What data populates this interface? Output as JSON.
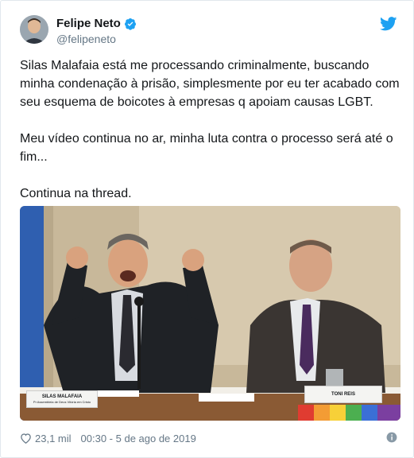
{
  "tweet": {
    "author": {
      "name": "Felipe Neto",
      "handle": "@felipeneto",
      "verified": true
    },
    "paragraphs": [
      "Silas Malafaia está me processando criminalmente, buscando minha condenação à prisão, simplesmente por eu ter acabado com seu esquema de boicotes à empresas q apoiam causas LGBT.",
      "Meu vídeo continua no ar, minha luta contra o processo será até o fim...",
      "Continua na thread."
    ],
    "photo": {
      "nameplate_left": "SILAS MALAFAIA",
      "nameplate_left_sub": "Pr Assembleia de Deus Vitória em Cristo",
      "nameplate_right": "TONI REIS"
    },
    "likes": "23,1 mil",
    "timestamp": "00:30 - 5 de ago de 2019"
  },
  "icons": {
    "verified": "verified-badge-icon",
    "brand": "twitter-bird-icon",
    "like": "heart-icon",
    "info": "info-icon"
  },
  "colors": {
    "brand_blue": "#1da1f2",
    "text": "#14171a",
    "secondary": "#657786",
    "border": "#e1e8ed"
  }
}
